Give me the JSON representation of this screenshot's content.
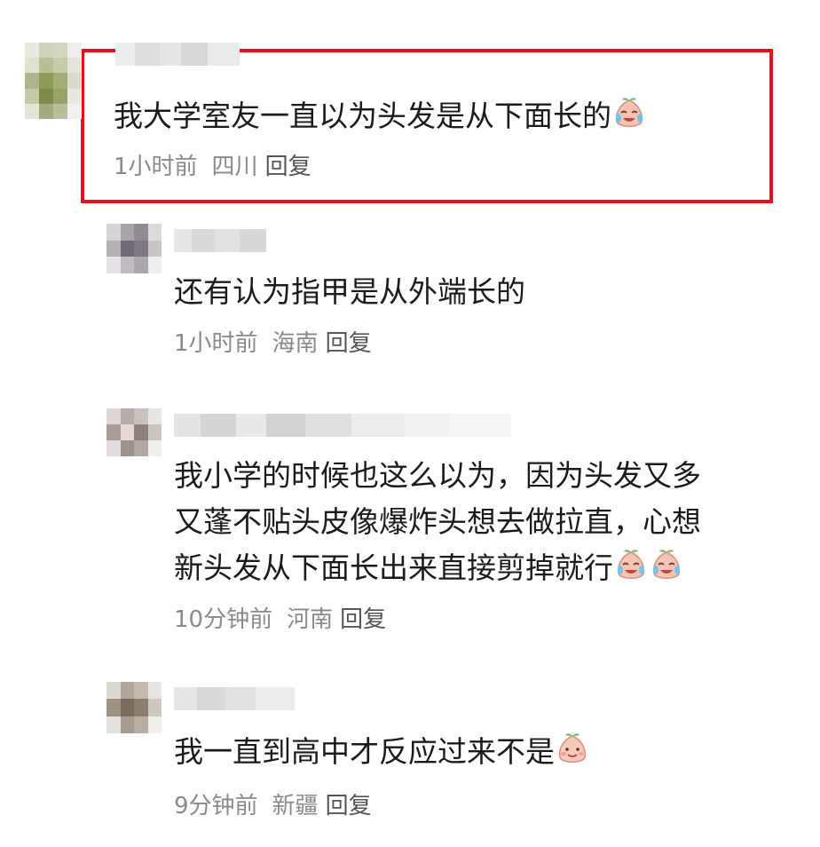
{
  "comments": [
    {
      "text": "我大学室友一直以为头发是从下面长的",
      "time": "1小时前",
      "location": "四川",
      "reply_label": "回复",
      "emoji": "laughing-crying-peach-emoji"
    },
    {
      "text": "还有认为指甲是从外端长的",
      "time": "1小时前",
      "location": "海南",
      "reply_label": "回复"
    },
    {
      "lines": [
        "我小学的时候也这么以为，因为头发又多",
        "又蓬不贴头皮像爆炸头想去做拉直，心想",
        "新头发从下面长出来直接剪掉就行"
      ],
      "time": "10分钟前",
      "location": "河南",
      "reply_label": "回复",
      "emoji": "laughing-crying-peach-emoji"
    },
    {
      "text": "我一直到高中才反应过来不是",
      "time": "9分钟前",
      "location": "新疆",
      "reply_label": "回复",
      "emoji": "smiling-peach-emoji"
    }
  ],
  "colors": {
    "highlight_border": "#e6111c",
    "meta_text": "#8a8a8a",
    "body_text": "#1b1b1b"
  }
}
